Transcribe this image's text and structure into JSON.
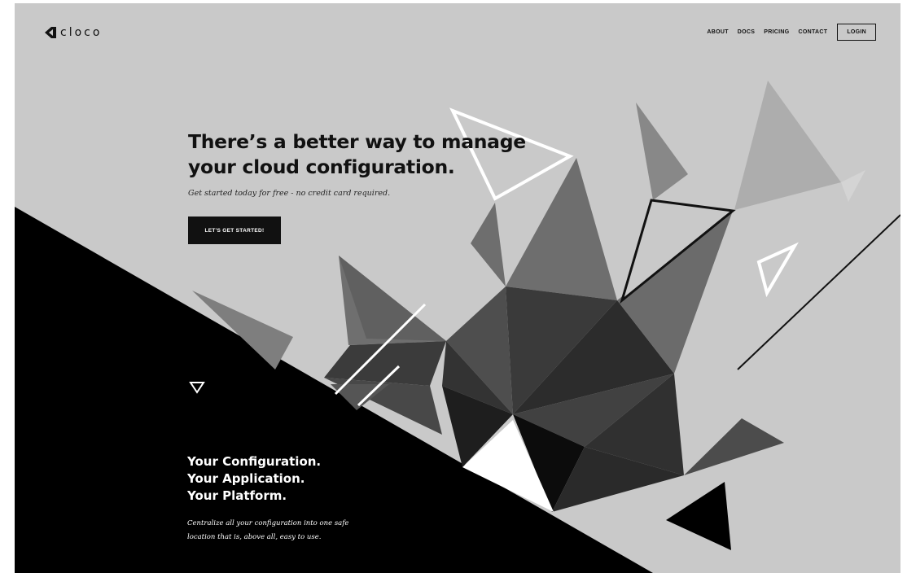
{
  "brand": {
    "name": "cloco",
    "logo_icon": "cloco-logo-icon"
  },
  "nav": {
    "items": [
      "ABOUT",
      "DOCS",
      "PRICING",
      "CONTACT"
    ],
    "login": "LOGIN"
  },
  "hero": {
    "title_line1": "There’s a better way to manage",
    "title_line2": "your cloud configuration.",
    "subtitle": "Get started today for free - no credit card required.",
    "cta": "LET'S GET STARTED!"
  },
  "section": {
    "icon": "triangle-down-icon",
    "title_lines": [
      "Your Configuration.",
      "Your Application.",
      "Your Platform."
    ],
    "description_lines": [
      "Centralize all your configuration into one safe",
      "location that is, above all, easy to use."
    ]
  },
  "colors": {
    "background": "#c9c9c9",
    "dark": "#000000",
    "text": "#111111"
  }
}
